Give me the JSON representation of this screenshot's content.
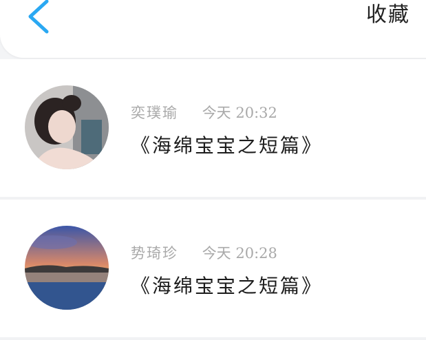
{
  "header": {
    "title": "收藏",
    "back_icon": "chevron-left-icon",
    "accent": "#2aa8f2"
  },
  "items": [
    {
      "name": "奕璞瑜",
      "time": "今天 20:32",
      "title": "《海绵宝宝之短篇》",
      "avatar": "portrait-avatar"
    },
    {
      "name": "势琦珍",
      "time": "今天 20:28",
      "title": "《海绵宝宝之短篇》",
      "avatar": "sunset-lake-avatar"
    }
  ]
}
